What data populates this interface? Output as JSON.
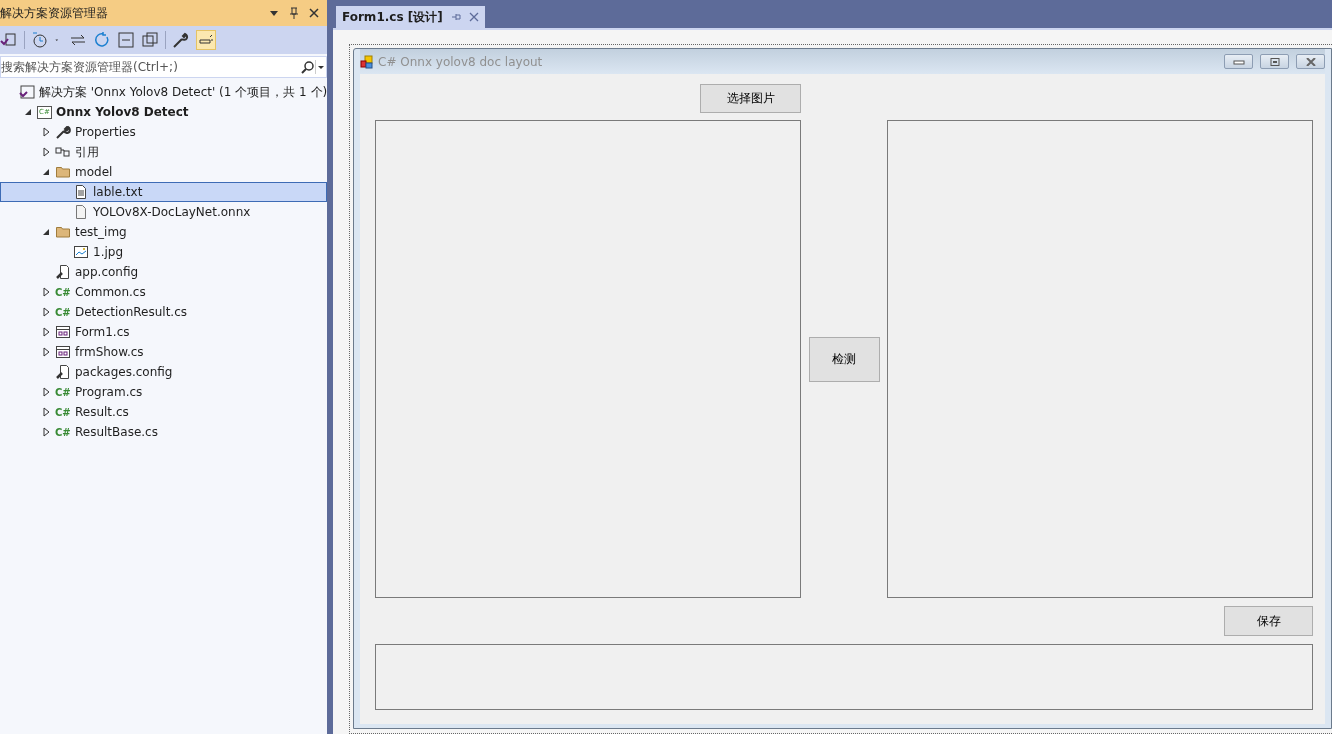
{
  "explorer": {
    "title": "解决方案资源管理器",
    "search": {
      "placeholder": "搜索解决方案资源管理器(Ctrl+;)"
    },
    "tree": [
      {
        "label": "解决方案 'Onnx Yolov8 Detect' (1 个项目，共 1 个)",
        "kind": "solution",
        "selected": false,
        "children": [
          {
            "label": "Onnx Yolov8 Detect",
            "kind": "project",
            "icon_text": "C#",
            "expanded": true,
            "selected": false,
            "children": [
              {
                "label": "Properties",
                "kind": "wrench",
                "expanded": false,
                "selected": false
              },
              {
                "label": "引用",
                "kind": "refs",
                "expanded": false,
                "selected": false
              },
              {
                "label": "model",
                "kind": "folder",
                "expanded": true,
                "selected": false,
                "children": [
                  {
                    "label": "lable.txt",
                    "kind": "text",
                    "selected": true
                  },
                  {
                    "label": "YOLOv8X-DocLayNet.onnx",
                    "kind": "file",
                    "selected": false
                  }
                ]
              },
              {
                "label": "test_img",
                "kind": "folder",
                "expanded": true,
                "selected": false,
                "children": [
                  {
                    "label": "1.jpg",
                    "kind": "image",
                    "selected": false
                  }
                ]
              },
              {
                "label": "app.config",
                "kind": "config",
                "selected": false
              },
              {
                "label": "Common.cs",
                "kind": "cs",
                "icon_text": "C#",
                "expanded": false,
                "selected": false
              },
              {
                "label": "DetectionResult.cs",
                "kind": "cs",
                "icon_text": "C#",
                "expanded": false,
                "selected": false
              },
              {
                "label": "Form1.cs",
                "kind": "form",
                "expanded": false,
                "selected": false
              },
              {
                "label": "frmShow.cs",
                "kind": "form",
                "expanded": false,
                "selected": false
              },
              {
                "label": "packages.config",
                "kind": "config",
                "selected": false
              },
              {
                "label": "Program.cs",
                "kind": "cs",
                "icon_text": "C#",
                "expanded": false,
                "selected": false
              },
              {
                "label": "Result.cs",
                "kind": "cs",
                "icon_text": "C#",
                "expanded": false,
                "selected": false
              },
              {
                "label": "ResultBase.cs",
                "kind": "cs",
                "icon_text": "C#",
                "expanded": false,
                "selected": false
              }
            ]
          }
        ]
      }
    ]
  },
  "tabs": [
    {
      "label": "Form1.cs [设计]",
      "selected": true
    }
  ],
  "form": {
    "title": "C# Onnx yolov8 doc layout",
    "select_button": "选择图片",
    "detect_button": "检测",
    "save_button": "保存"
  }
}
